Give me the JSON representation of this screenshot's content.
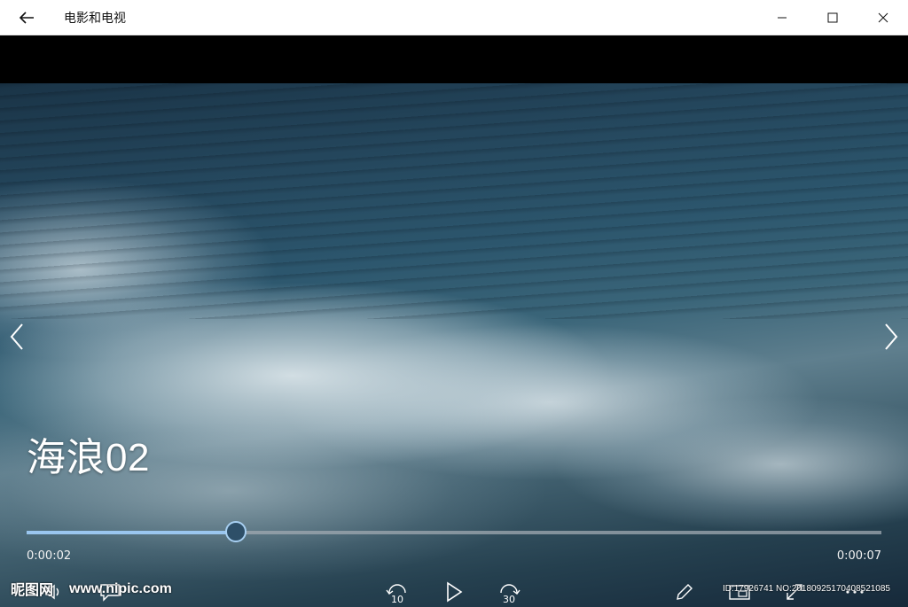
{
  "window": {
    "app_title": "电影和电视",
    "icons": {
      "back": "back-arrow-icon",
      "minimize": "minimize-icon",
      "maximize": "maximize-icon",
      "close": "close-icon"
    }
  },
  "player": {
    "video_title": "海浪02",
    "time_current": "0:00:02",
    "time_total": "0:00:07",
    "progress_fraction": 0.245,
    "accent_color": "#9ac6ef",
    "controls": {
      "skip_back_seconds": "10",
      "skip_forward_seconds": "30"
    }
  },
  "watermark": {
    "logo": "昵图网",
    "site": "www.nipic.com",
    "id_text": "ID:17926741 NO:20180925170408521085"
  }
}
